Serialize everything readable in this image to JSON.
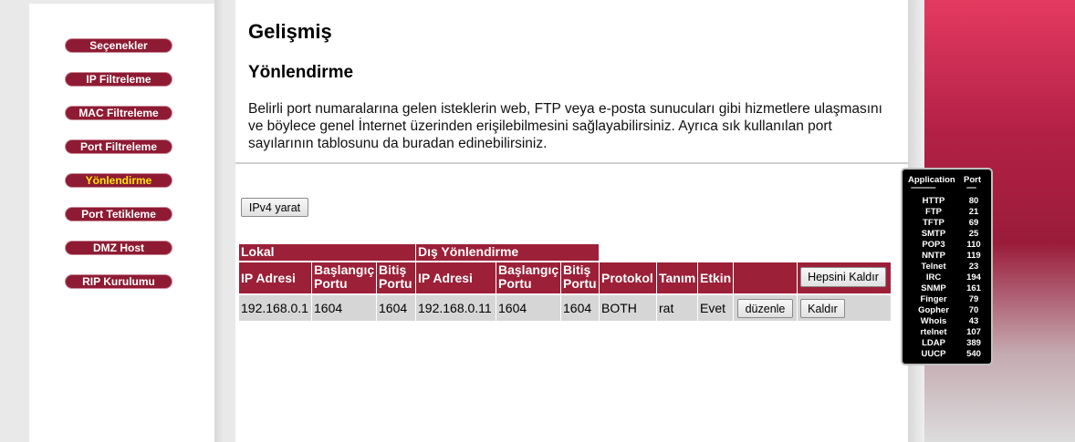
{
  "nav": [
    {
      "label": "Seçenekler",
      "active": false
    },
    {
      "label": "IP Filtreleme",
      "active": false
    },
    {
      "label": "MAC Filtreleme",
      "active": false
    },
    {
      "label": "Port Filtreleme",
      "active": false
    },
    {
      "label": "Yönlendirme",
      "active": true
    },
    {
      "label": "Port Tetikleme",
      "active": false
    },
    {
      "label": "DMZ Host",
      "active": false
    },
    {
      "label": "RIP Kurulumu",
      "active": false
    }
  ],
  "page": {
    "title": "Gelişmiş",
    "section": "Yönlendirme",
    "description": "Belirli port numaralarına gelen isteklerin web, FTP veya e-posta sunucuları gibi hizmetlere ulaşmasını ve böylece genel İnternet üzerinden erişilebilmesini sağlayabilirsiniz. Ayrıca sık kullanılan port sayılarının tablosunu da buradan edinebilirsiniz."
  },
  "create_button": "IPv4 yarat",
  "table": {
    "group_local": "Lokal",
    "group_external": "Dış Yönlendirme",
    "headers": {
      "ip": "IP Adresi",
      "start": "Başlangıç Portu",
      "end": "Bitiş Portu",
      "ext_ip": "IP Adresi",
      "ext_start": "Başlangıç Portu",
      "ext_end": "Bitiş Portu",
      "protocol": "Protokol",
      "desc": "Tanım",
      "enabled": "Etkin"
    },
    "remove_all_label": "Hepsini Kaldır",
    "rows": [
      {
        "ip": "192.168.0.1",
        "start": "1604",
        "end": "1604",
        "ext_ip": "192.168.0.11",
        "ext_start": "1604",
        "ext_end": "1604",
        "protocol": "BOTH",
        "desc": "rat",
        "enabled": "Evet",
        "edit_label": "düzenle",
        "remove_label": "Kaldır"
      }
    ]
  },
  "port_reference": {
    "col_app": "Application",
    "col_port": "Port",
    "dash_app": "----------------",
    "dash_port": "------",
    "items": [
      {
        "app": "HTTP",
        "port": "80"
      },
      {
        "app": "FTP",
        "port": "21"
      },
      {
        "app": "TFTP",
        "port": "69"
      },
      {
        "app": "SMTP",
        "port": "25"
      },
      {
        "app": "POP3",
        "port": "110"
      },
      {
        "app": "NNTP",
        "port": "119"
      },
      {
        "app": "Telnet",
        "port": "23"
      },
      {
        "app": "IRC",
        "port": "194"
      },
      {
        "app": "SNMP",
        "port": "161"
      },
      {
        "app": "Finger",
        "port": "79"
      },
      {
        "app": "Gopher",
        "port": "70"
      },
      {
        "app": "Whois",
        "port": "43"
      },
      {
        "app": "rtelnet",
        "port": "107"
      },
      {
        "app": "LDAP",
        "port": "389"
      },
      {
        "app": "UUCP",
        "port": "540"
      }
    ]
  },
  "colors": {
    "accent": "#9c2038",
    "nav_bg": "#8e1b33",
    "active_nav_text": "#ffe600",
    "row_bg": "#d6d6d6"
  }
}
